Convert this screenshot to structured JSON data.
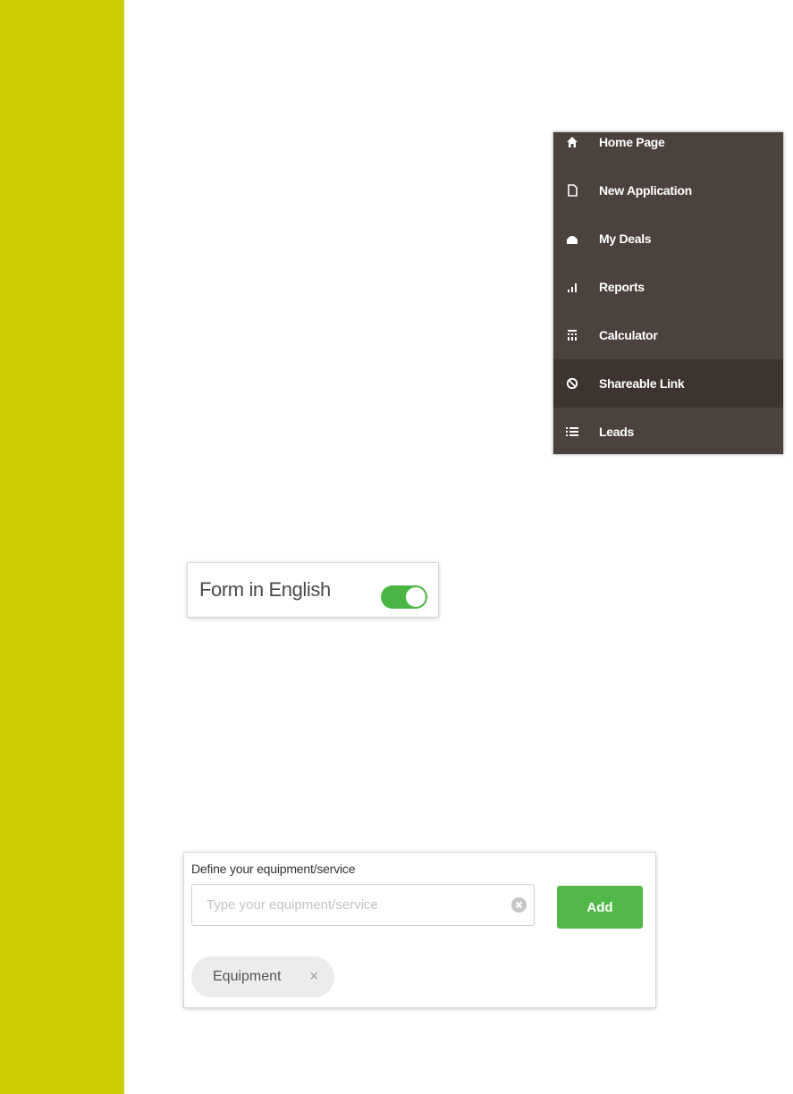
{
  "nav": {
    "items": [
      {
        "label": "Home Page",
        "icon": "home-icon",
        "active": false
      },
      {
        "label": "New Application",
        "icon": "document-icon",
        "active": false
      },
      {
        "label": "My Deals",
        "icon": "briefcase-icon",
        "active": false
      },
      {
        "label": "Reports",
        "icon": "bar-chart-icon",
        "active": false
      },
      {
        "label": "Calculator",
        "icon": "calculator-icon",
        "active": false
      },
      {
        "label": "Shareable Link",
        "icon": "link-icon",
        "active": true
      },
      {
        "label": "Leads",
        "icon": "list-icon",
        "active": false
      }
    ]
  },
  "toggle": {
    "label": "Form in English",
    "on": true
  },
  "equipment": {
    "label": "Define your equipment/service",
    "placeholder": "Type your equipment/service",
    "value": "",
    "add_label": "Add",
    "chips": [
      {
        "label": "Equipment",
        "remove_symbol": "×"
      }
    ]
  },
  "colors": {
    "side_band": "#cccc00",
    "nav_background": "#4b413d",
    "nav_active": "#3d3430",
    "toggle_on": "#4bb543",
    "add_button": "#52b848"
  }
}
